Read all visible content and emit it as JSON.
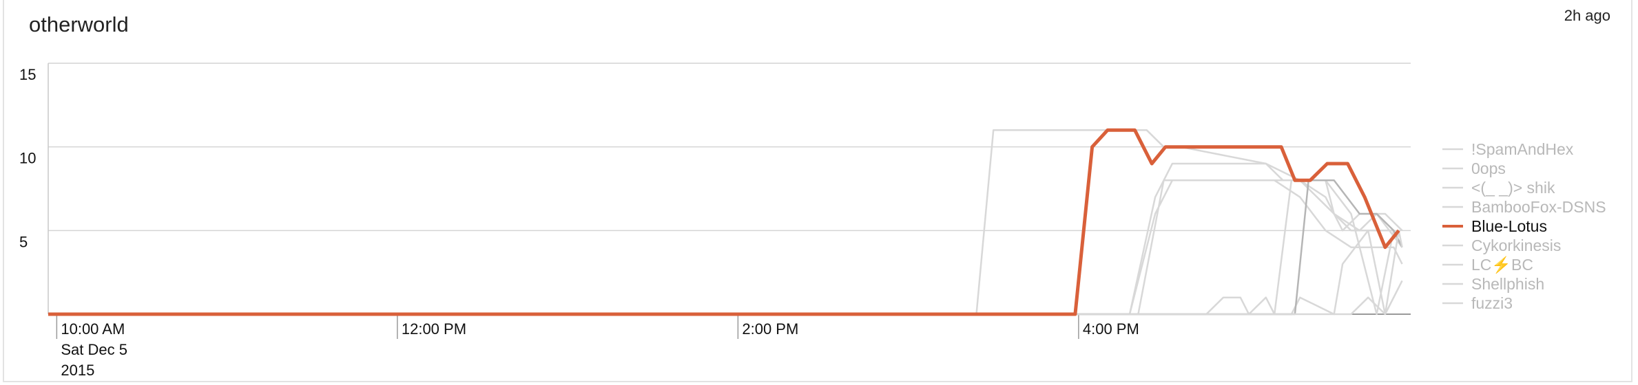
{
  "header": {
    "title": "otherworld",
    "timestamp": "2h ago"
  },
  "chart_data": {
    "type": "line",
    "title": "otherworld",
    "xlabel": "",
    "ylabel": "",
    "ylim": [
      0,
      15
    ],
    "yticks": [
      "15",
      "10",
      "5"
    ],
    "xlim_hours": [
      9.95,
      17.95
    ],
    "xticks": [
      {
        "hour": 10,
        "lines": [
          "10:00 AM",
          "Sat Dec 5",
          "2015"
        ]
      },
      {
        "hour": 12,
        "lines": [
          "12:00 PM"
        ]
      },
      {
        "hour": 14,
        "lines": [
          "2:00 PM"
        ]
      },
      {
        "hour": 16,
        "lines": [
          "4:00 PM"
        ]
      }
    ],
    "grid": true,
    "legend_position": "right",
    "highlighted_series": "Blue-Lotus",
    "colors": {
      "highlight": "#d9603a",
      "muted": "#d8d8d8",
      "muted_dark": "#b5b5b5",
      "grid": "#d4d4d4"
    },
    "series": [
      {
        "name": "!SpamAndHex",
        "x": [
          9.95,
          15.4,
          15.5,
          16.2,
          16.4,
          16.5,
          16.6,
          17.1,
          17.3,
          17.6,
          17.7,
          17.85,
          17.9
        ],
        "y": [
          0,
          0,
          11,
          11,
          11,
          10,
          10,
          9,
          8,
          5,
          5,
          5,
          4
        ]
      },
      {
        "name": "0ops",
        "x": [
          9.95,
          16.3,
          16.45,
          16.55,
          16.7,
          17.1,
          17.2,
          17.45,
          17.5,
          17.65,
          17.75,
          17.9
        ],
        "y": [
          0,
          0,
          7,
          9,
          9,
          9,
          8,
          8,
          6,
          5,
          6,
          4
        ]
      },
      {
        "name": "<(_ _)> shik",
        "x": [
          9.95,
          16.35,
          16.5,
          16.6,
          17.1,
          17.15,
          17.3,
          17.45,
          17.55,
          17.65,
          17.8,
          17.9
        ],
        "y": [
          0,
          0,
          8,
          8,
          8,
          8,
          8,
          7,
          5,
          6,
          6,
          5
        ]
      },
      {
        "name": "BambooFox-DSNS",
        "x": [
          9.95,
          16.3,
          16.45,
          16.55,
          16.85,
          17.05,
          17.15,
          17.3,
          17.45,
          17.6,
          17.7,
          17.85,
          17.9
        ],
        "y": [
          0,
          0,
          6,
          8,
          8,
          8,
          8,
          7,
          5,
          4,
          4,
          4,
          3
        ]
      },
      {
        "name": "Blue-Lotus",
        "x": [
          9.95,
          15.98,
          16.08,
          16.17,
          16.33,
          16.43,
          16.51,
          16.68,
          16.85,
          17.1,
          17.19,
          17.27,
          17.36,
          17.46,
          17.58,
          17.68,
          17.8,
          17.88
        ],
        "y": [
          0,
          0,
          10,
          11,
          11,
          9,
          10,
          10,
          10,
          10,
          10,
          8,
          8,
          9,
          9,
          7,
          4,
          5
        ]
      },
      {
        "name": "Cykorkinesis",
        "x": [
          9.95,
          17.0,
          17.1,
          17.25,
          17.3,
          17.5,
          17.6,
          17.7,
          17.8,
          17.9
        ],
        "y": [
          0,
          0,
          0,
          0,
          1,
          0,
          0,
          1,
          0,
          2
        ]
      },
      {
        "name": "LC⚡BC",
        "x": [
          9.95,
          16.75,
          16.85,
          16.95,
          17.0,
          17.1,
          17.15,
          17.25,
          17.3,
          17.45,
          17.6,
          17.75,
          17.85,
          17.9
        ],
        "y": [
          0,
          0,
          1,
          1,
          0,
          1,
          0,
          8,
          8,
          8,
          6,
          0,
          5,
          4
        ]
      },
      {
        "name": "Shellphish",
        "x": [
          9.95,
          17.2,
          17.27,
          17.35,
          17.5,
          17.65,
          17.75,
          17.85,
          17.9
        ],
        "y": [
          0,
          0,
          0,
          8,
          8,
          6,
          6,
          5,
          4
        ]
      },
      {
        "name": "fuzzi3",
        "x": [
          9.95,
          17.5,
          17.55,
          17.7,
          17.8,
          17.88,
          17.9
        ],
        "y": [
          0,
          0,
          3,
          5,
          0,
          5,
          4
        ]
      }
    ]
  }
}
